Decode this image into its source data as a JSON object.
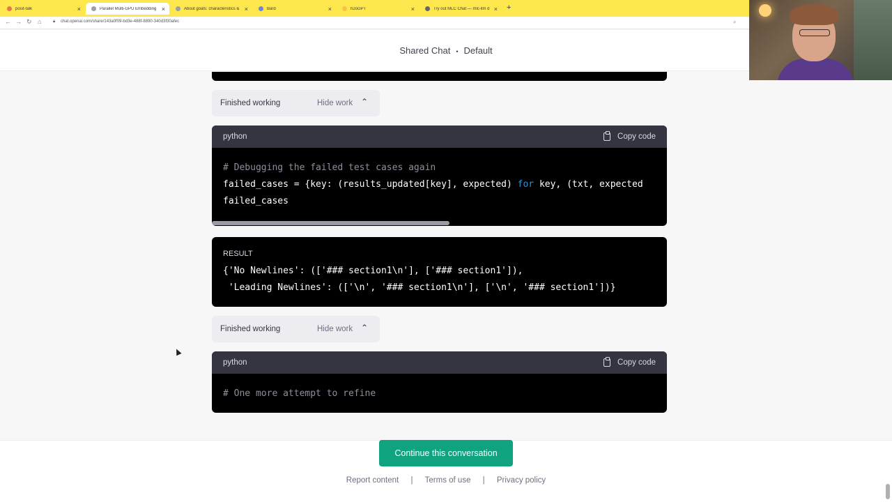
{
  "browser": {
    "tabs": [
      {
        "title": "posit-talk",
        "favicon_color": "#e8744a",
        "active": false
      },
      {
        "title": "Parallel Multi-GPU Embedding",
        "favicon_color": "#9aa0a6",
        "active": true
      },
      {
        "title": "About goats: characteristics &",
        "favicon_color": "#9aa0a6",
        "active": false
      },
      {
        "title": "Bard",
        "favicon_color": "#6f86d6",
        "active": false
      },
      {
        "title": "h2oGPT",
        "favicon_color": "#f5c542",
        "active": false
      },
      {
        "title": "Try out MLC Chat — mlc-llm d",
        "favicon_color": "#666666",
        "active": false
      }
    ],
    "new_tab": "+",
    "url": "chat.openai.com/share/143a0f09-bd3e-488f-8890-340d3f30afec"
  },
  "header": {
    "title": "Shared Chat",
    "separator": "•",
    "model": "Default"
  },
  "blocks": {
    "finished_1": {
      "label": "Finished working",
      "toggle": "Hide work"
    },
    "code_1": {
      "lang": "python",
      "copy": "Copy code",
      "line1": "# Debugging the failed test cases again",
      "line2_a": "failed_cases = {key: (results_updated[key], expected) ",
      "line2_kw": "for",
      "line2_b": " key, (txt, expected",
      "line3": "failed_cases"
    },
    "result": {
      "label": "RESULT",
      "line1": "{'No Newlines': (['### section1\\n'], ['### section1']),",
      "line2": " 'Leading Newlines': (['\\n', '### section1\\n'], ['\\n', '### section1'])}"
    },
    "finished_2": {
      "label": "Finished working",
      "toggle": "Hide work"
    },
    "code_2": {
      "lang": "python",
      "copy": "Copy code",
      "line1": "# One more attempt to refine"
    }
  },
  "footer": {
    "continue": "Continue this conversation",
    "links": [
      "Report content",
      "Terms of use",
      "Privacy policy"
    ],
    "sep": "|"
  },
  "icons": {
    "chevron": "chevron-up-icon",
    "copy": "clipboard-icon"
  }
}
